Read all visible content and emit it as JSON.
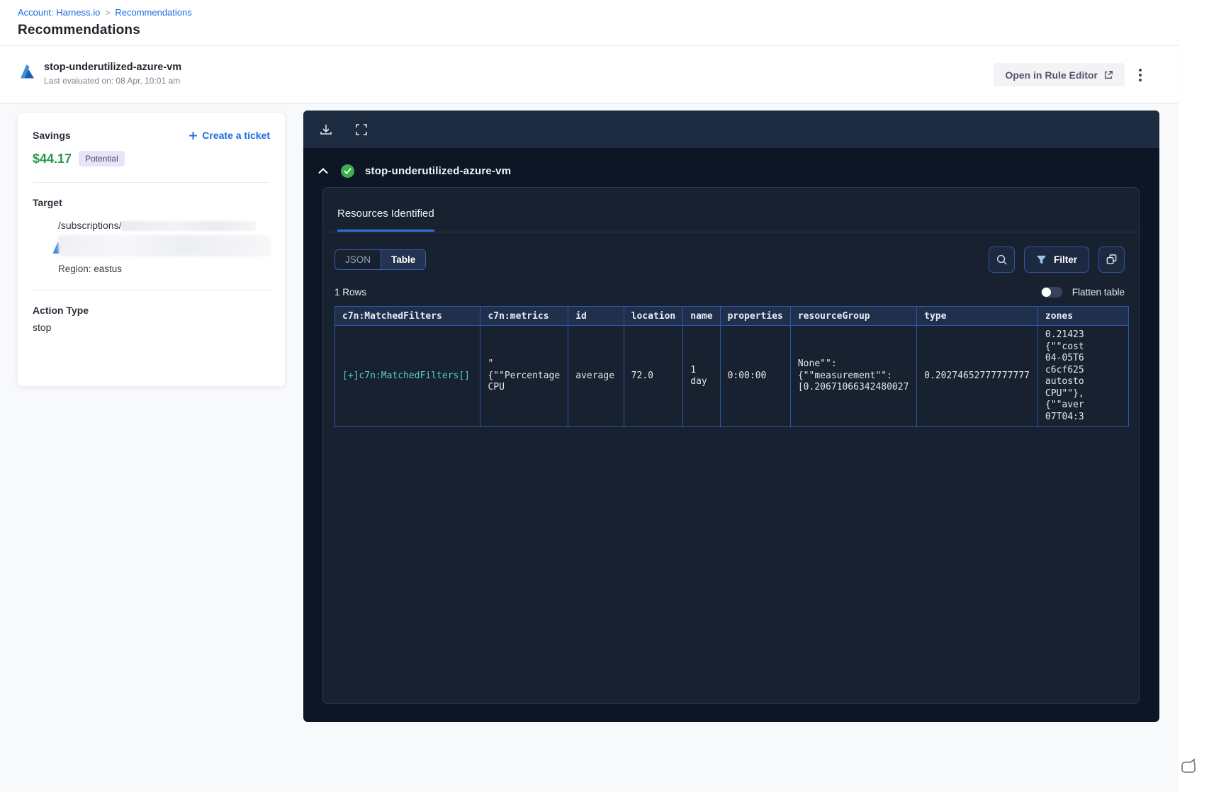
{
  "breadcrumb": {
    "account": "Account: Harness.io",
    "separator": ">",
    "current": "Recommendations"
  },
  "page_title": "Recommendations",
  "header": {
    "title": "stop-underutilized-azure-vm",
    "subtitle": "Last evaluated on: 08 Apr, 10:01 am",
    "open_rule_editor_label": "Open in Rule Editor"
  },
  "sidebar": {
    "savings_label": "Savings",
    "savings_value": "$44.17",
    "savings_badge": "Potential",
    "create_ticket_label": "Create a ticket",
    "target_label": "Target",
    "target_path": "/subscriptions/",
    "region": "Region: eastus",
    "action_type_label": "Action Type",
    "action_type_value": "stop"
  },
  "panel": {
    "title": "stop-underutilized-azure-vm",
    "tab_label": "Resources Identified",
    "view_toggle": {
      "json": "JSON",
      "table": "Table"
    },
    "filter_label": "Filter",
    "rows_count": "1 Rows",
    "flatten_label": "Flatten table",
    "table": {
      "headers": [
        "c7n:MatchedFilters",
        "c7n:metrics",
        "id",
        "location",
        "name",
        "properties",
        "resourceGroup",
        "type",
        "zones"
      ],
      "row": [
        "[+]c7n:MatchedFilters[]",
        "\"\n{\"\"Percentage\nCPU",
        "average",
        "72.0",
        "1\nday",
        "0:00:00",
        "None\"\":\n{\"\"measurement\"\":\n[0.20671066342480027",
        "0.20274652777777777",
        "0.21423\n{\"\"cost\n04-05T6\nc6cf625\nautosto\nCPU\"\"},\n{\"\"aver\n07T04:3"
      ]
    }
  },
  "icons": {
    "azure": "azure-logo",
    "download": "download-icon",
    "fullscreen": "fullscreen-icon",
    "collapse": "chevron-up-icon",
    "success": "check-circle-icon",
    "search": "search-icon",
    "filter": "filter-funnel-icon",
    "copy": "copy-icon",
    "kebab": "kebab-menu-icon",
    "external": "external-link-icon",
    "chat": "chat-bubble-icon"
  },
  "colors": {
    "accent_blue": "#1b6ce0",
    "savings_green": "#27994d",
    "success_green": "#3fae4d",
    "badge_bg": "#e8e3f9",
    "panel_bg": "#0c1624",
    "panel_toolbar_bg": "#1d2b41",
    "card_bg": "#17212f",
    "table_border_blue": "#2d57a8",
    "table_header_bg": "#202f4c",
    "cell_link_cyan": "#59cfc4",
    "tab_underline": "#2f6fd6"
  }
}
